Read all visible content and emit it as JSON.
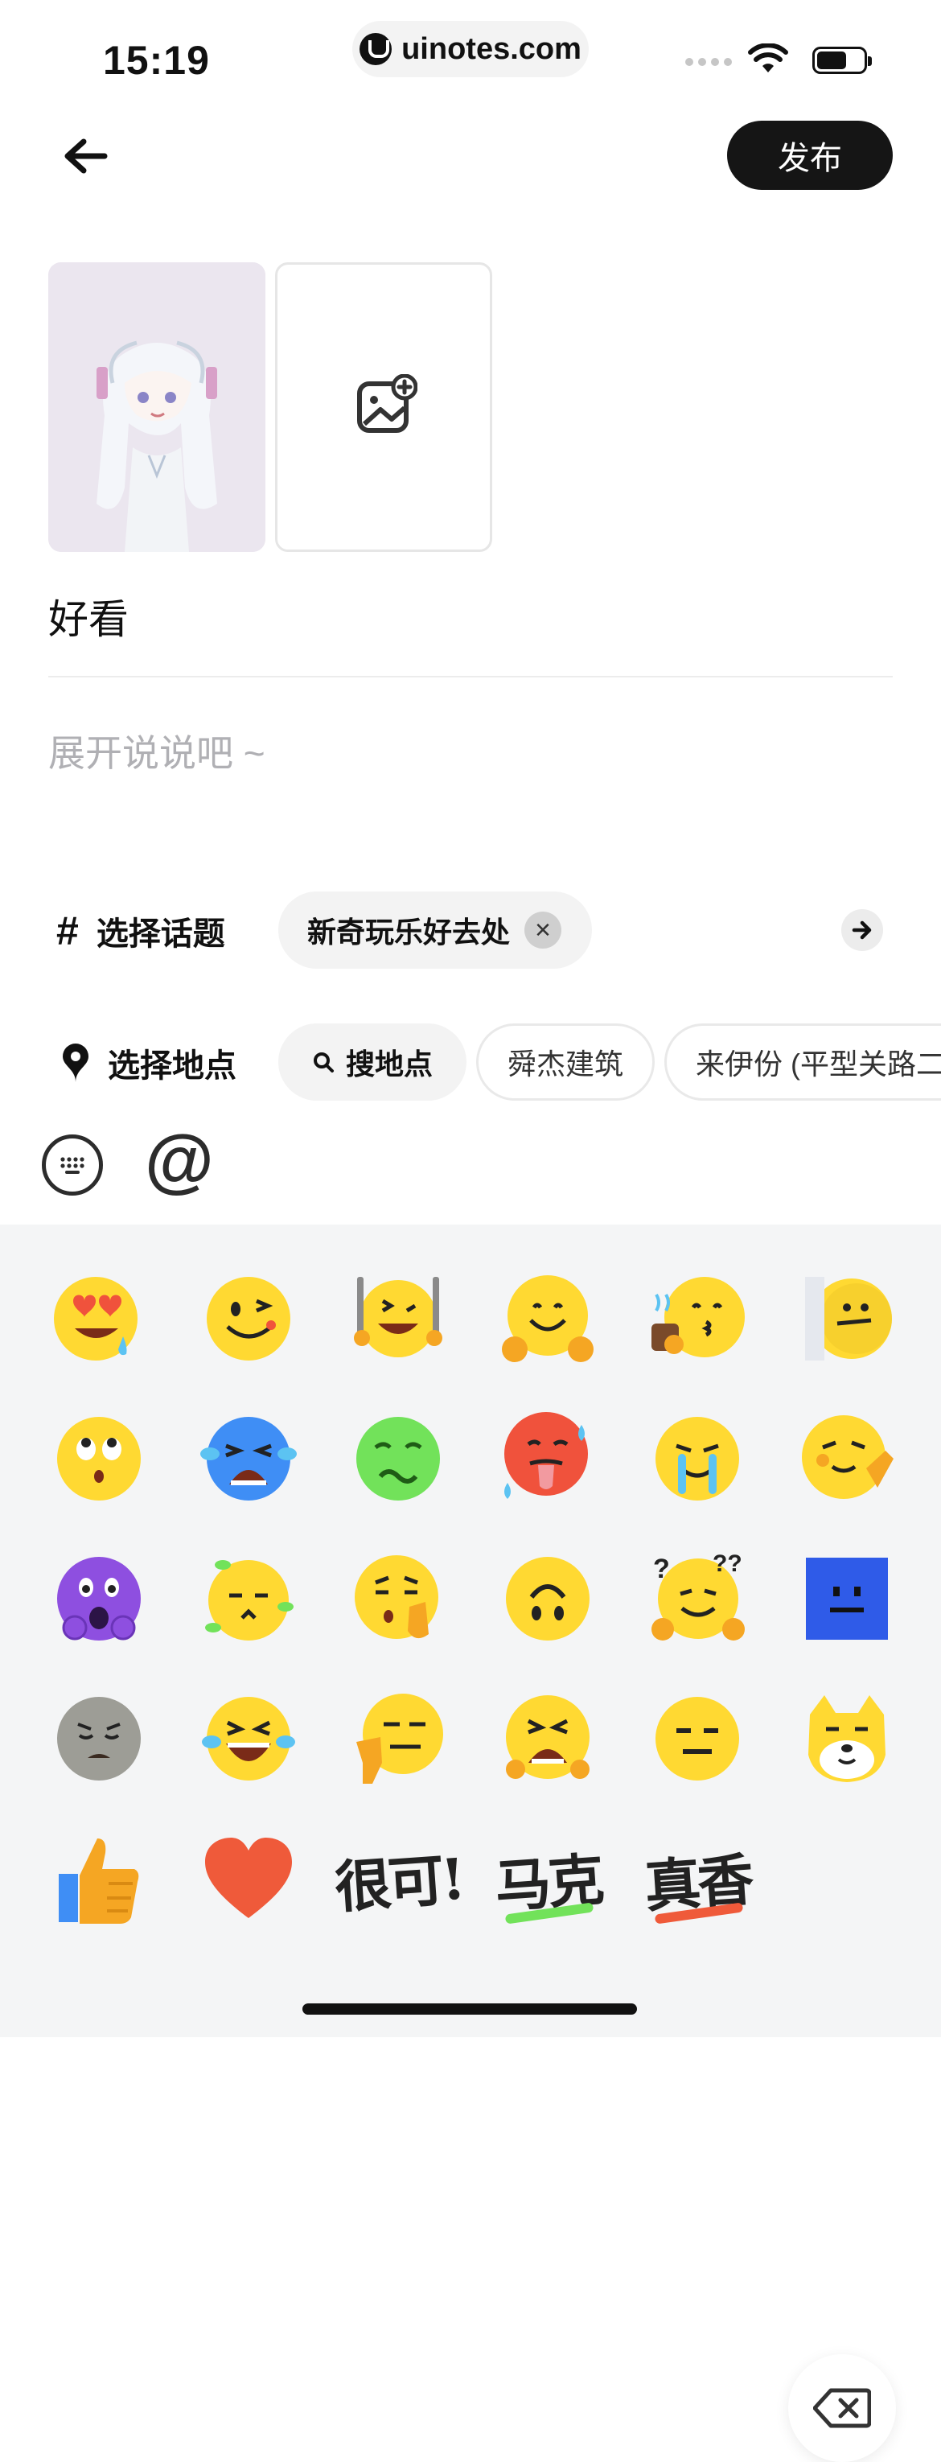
{
  "status_bar": {
    "time": "15:19",
    "url": "uinotes.com"
  },
  "header": {
    "publish_label": "发布"
  },
  "post": {
    "title": "好看",
    "description_placeholder": "展开说说吧 ~"
  },
  "topic": {
    "label": "选择话题",
    "selected": "新奇玩乐好去处"
  },
  "location": {
    "label": "选择地点",
    "search_label": "搜地点",
    "suggestions": [
      "舜杰建筑",
      "来伊份 (平型关路二"
    ]
  },
  "emoji_panel": {
    "stickers": [
      "很可!",
      "马克",
      "真香"
    ]
  }
}
